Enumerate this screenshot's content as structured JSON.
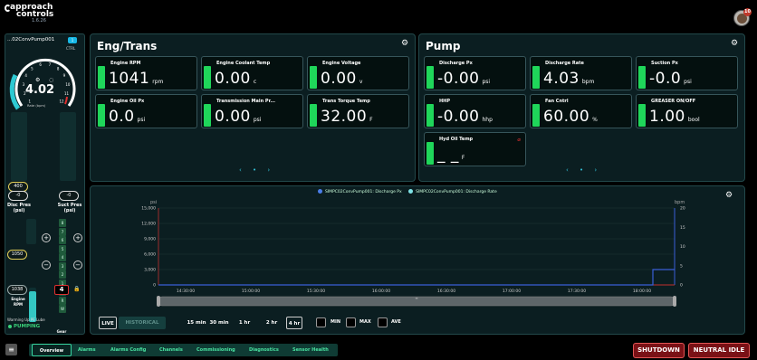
{
  "app": {
    "logo_line1": "approach",
    "logo_line2": "controls",
    "version": "1.6.26",
    "notification_count": "10"
  },
  "left": {
    "pump_name": "...02ConvPump001",
    "tag": "1",
    "ctrl": "CTRL",
    "rate": "4.02",
    "rate_label": "Rate (bpm)",
    "gauge_ticks": [
      "1",
      "2",
      "3",
      "4",
      "5",
      "6",
      "7",
      "8",
      "9",
      "10",
      "11",
      "12"
    ],
    "disc_setpoint": "400",
    "disc_value": "-0",
    "disc_label": "Disc Pres (psi)",
    "suct_value": "-0",
    "suct_label": "Suct Pres (psi)",
    "rpm_setpoint": "1050",
    "rpm_value": "1038",
    "rpm_label": "Engine RPM",
    "rpm_fill": 0.9,
    "gear_list": [
      "8",
      "7",
      "6",
      "5",
      "4",
      "3",
      "2",
      "1",
      "N",
      "R",
      "W"
    ],
    "gear_value": "4",
    "gear_label": "Gear",
    "warning": "Warming Up PE Lube",
    "pump_status": "PUMPING",
    "minus": "−",
    "plus": "+"
  },
  "eng": {
    "title": "Eng/Trans",
    "cards": [
      {
        "label": "Engine RPM",
        "value": "1041",
        "unit": "rpm"
      },
      {
        "label": "Engine Coolant Temp",
        "value": "0.00",
        "unit": "c"
      },
      {
        "label": "Engine Voltage",
        "value": "0.00",
        "unit": "v"
      },
      {
        "label": "Engine Oil Px",
        "value": "0.0",
        "unit": "psi"
      },
      {
        "label": "Transmission Main Pr...",
        "value": "0.00",
        "unit": "psi"
      },
      {
        "label": "Trans Torque Temp",
        "value": "32.00",
        "unit": "F"
      }
    ],
    "pager": "‹ • ›"
  },
  "pump": {
    "title": "Pump",
    "cards": [
      {
        "label": "Discharge Px",
        "value": "-0.00",
        "unit": "psi"
      },
      {
        "label": "Discharge Rate",
        "value": "4.03",
        "unit": "bpm"
      },
      {
        "label": "Suction Px",
        "value": "-0.0",
        "unit": "psi"
      },
      {
        "label": "HHP",
        "value": "-0.00",
        "unit": "hhp"
      },
      {
        "label": "Fan Cntrl",
        "value": "60.00",
        "unit": "%"
      },
      {
        "label": "GREASER ON/OFF",
        "value": "1.00",
        "unit": "bool"
      },
      {
        "label": "Hyd Oil Temp",
        "value": "_ _",
        "unit": "F"
      }
    ],
    "pager": "‹ • ›"
  },
  "chart": {
    "legend": [
      {
        "name": "SIMPC02ConvPump001: Discharge Px",
        "color": "#4a7de8"
      },
      {
        "name": "SIMPC02ConvPump001: Discharge Rate",
        "color": "#7fe3e6"
      }
    ],
    "left_axis_label": "psi",
    "right_axis_label": "bpm",
    "live": "LIVE",
    "historical": "HISTORICAL",
    "ranges": [
      "15 min",
      "30 min",
      "1 hr",
      "2 hr",
      "4 hr"
    ],
    "checks": [
      "MIN",
      "MAX",
      "AVE"
    ]
  },
  "chart_data": {
    "type": "line",
    "x": [
      "14:30:00",
      "15:00:00",
      "15:30:00",
      "16:00:00",
      "16:30:00",
      "17:00:00",
      "17:30:00",
      "18:00:00"
    ],
    "ylim_left": [
      0,
      15000
    ],
    "yticks_left": [
      "15,000",
      "12,000",
      "9,000",
      "6,000",
      "3,000",
      "0"
    ],
    "ylim_right": [
      0,
      20
    ],
    "yticks_right": [
      "20",
      "15",
      "10",
      "5",
      "0"
    ],
    "series": [
      {
        "name": "SIMPC02ConvPump001: Discharge Px",
        "axis": "left",
        "values": [
          0,
          0,
          0,
          0,
          0,
          0,
          0,
          0,
          0
        ]
      },
      {
        "name": "SIMPC02ConvPump001: Discharge Rate",
        "axis": "right",
        "values": [
          0,
          0,
          0,
          0,
          0,
          0,
          0,
          0,
          4
        ]
      }
    ]
  },
  "nav": {
    "menu": "≡",
    "tabs": [
      "Overview",
      "Alarms",
      "Alarms Config",
      "Channels",
      "Commissioning",
      "Diagnostics",
      "Sensor Health"
    ],
    "shutdown": "SHUTDOWN",
    "neutral_idle": "NEUTRAL IDLE"
  },
  "colors": {
    "accent": "#1fd65a",
    "cyan": "#33c0d6",
    "alarm": "#e03030",
    "panel": "#0b1e21"
  }
}
